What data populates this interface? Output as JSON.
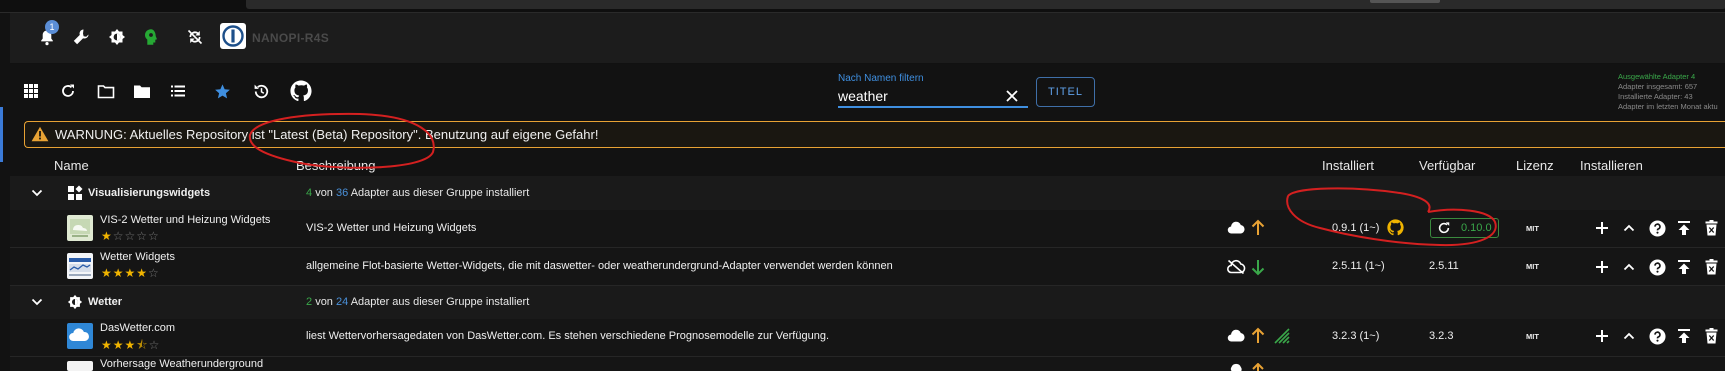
{
  "header": {
    "notifications_count": "1",
    "host_name": "NANOPI-R4S",
    "icons": [
      "bell-icon",
      "wrench-icon",
      "theme-toggle-icon",
      "expert-mode-icon",
      "sync-off-icon",
      "host-logo-icon"
    ]
  },
  "toolbar": {
    "icons": [
      "grid-view-icon",
      "refresh-icon",
      "folder-outline-icon",
      "folder-icon",
      "list-view-icon",
      "star-icon",
      "update-check-icon",
      "github-icon"
    ],
    "filter_label": "Nach Namen filtern",
    "filter_value": "weather",
    "title_button": "TITEL"
  },
  "stats": {
    "selected": "Ausgewählte Adapter 4",
    "total": "Adapter insgesamt: 657",
    "installed": "Installierte Adapter: 43",
    "last_month": "Adapter im letzten Monat aktu"
  },
  "warning": {
    "text": "WARNUNG: Aktuelles Repository ist \"Latest (Beta) Repository\". Benutzung auf eigene Gefahr!"
  },
  "table": {
    "headers": {
      "name": "Name",
      "description": "Beschreibung",
      "installed": "Installiert",
      "available": "Verfügbar",
      "license": "Lizenz",
      "install": "Installieren"
    },
    "groups": [
      {
        "name": "Visualisierungswidgets",
        "installed_count": "4",
        "von": "von",
        "total_count": "36",
        "suffix": "Adapter aus dieser Gruppe installiert"
      },
      {
        "name": "Wetter",
        "installed_count": "2",
        "von": "von",
        "total_count": "24",
        "suffix": "Adapter aus dieser Gruppe installiert"
      }
    ],
    "adapters": [
      {
        "name": "VIS-2 Wetter und Heizung Widgets",
        "rating": 1,
        "description": "VIS-2 Wetter und Heizung Widgets",
        "installed": "0.9.1 (1~)",
        "available": "0.10.0",
        "license": "MIT"
      },
      {
        "name": "Wetter Widgets",
        "rating": 4,
        "description": "allgemeine Flot-basierte Wetter-Widgets, die mit daswetter- oder weatherundergrund-Adapter verwendet werden können",
        "installed": "2.5.11 (1~)",
        "available": "2.5.11",
        "license": "MIT"
      },
      {
        "name": "DasWetter.com",
        "rating": 3.5,
        "description": "liest Wettervorhersagedaten von DasWetter.com. Es stehen verschiedene Prognosemodelle zur Verfügung.",
        "installed": "3.2.3 (1~)",
        "available": "3.2.3",
        "license": "MIT"
      },
      {
        "name": "Vorhersage Weatherunderground"
      }
    ]
  },
  "colors": {
    "accent": "#3f8fe0",
    "warning": "#e8a234",
    "success": "#3aa84a",
    "star": "#f0b400",
    "annotation": "#d42020"
  }
}
